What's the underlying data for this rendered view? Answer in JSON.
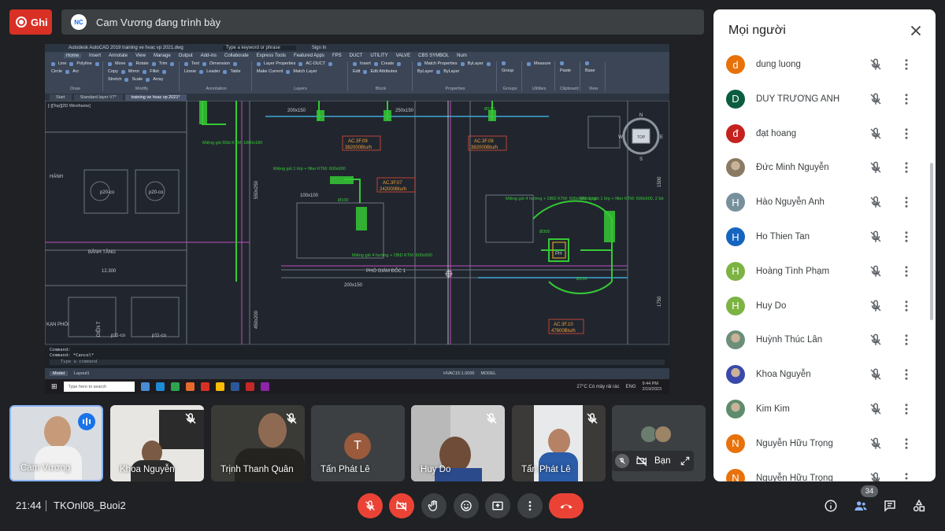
{
  "recording": {
    "label": "Ghi"
  },
  "presenter": {
    "initials": "NC",
    "text": "Cam Vương đang trình bày"
  },
  "shared_screen": {
    "window_title": "Autodesk AutoCAD 2019   training ve hvac vp 2021.dwg",
    "search_placeholder": "Type a keyword or phrase",
    "sign_in": "Sign In",
    "menu": [
      "Home",
      "Insert",
      "Annotate",
      "View",
      "Manage",
      "Output",
      "Add-ins",
      "Collaborate",
      "Express Tools",
      "Featured Apps",
      "FPS",
      "DUCT",
      "UTILITY",
      "VALVE",
      "CBS SYMBOL",
      "Num"
    ],
    "ribbon_groups": [
      {
        "label": "Draw",
        "items": [
          "Line",
          "Polyline",
          "Circle",
          "Arc"
        ]
      },
      {
        "label": "Modify",
        "items": [
          "Move",
          "Rotate",
          "Trim",
          "Copy",
          "Mirror",
          "Fillet",
          "Stretch",
          "Scale",
          "Array"
        ]
      },
      {
        "label": "Annotation",
        "items": [
          "Text",
          "Dimension",
          "Linear",
          "Leader",
          "Table"
        ]
      },
      {
        "label": "Layers",
        "items": [
          "Layer Properties",
          "AC-DUCT",
          "Make Current",
          "Match Layer"
        ]
      },
      {
        "label": "Block",
        "items": [
          "Insert",
          "Create",
          "Edit",
          "Edit Attributes"
        ]
      },
      {
        "label": "Properties",
        "items": [
          "Match Properties",
          "ByLayer",
          "ByLayer",
          "ByLayer"
        ]
      },
      {
        "label": "Groups",
        "items": [
          "Group"
        ]
      },
      {
        "label": "Utilities",
        "items": [
          "Measure"
        ]
      },
      {
        "label": "Clipboard",
        "items": [
          "Paste"
        ]
      },
      {
        "label": "View",
        "items": [
          "Base"
        ]
      }
    ],
    "doc_tabs": [
      "Start",
      "Standard layer V7*",
      "training ve hvac vp 2021*"
    ],
    "viewport_label": "[-][Top][2D Wireframe]",
    "viewcube": {
      "n": "N",
      "s": "S",
      "e": "E",
      "w": "W",
      "top": "TOP"
    },
    "drawing_labels": {
      "ac3f09": "AC.3F.09",
      "ac3f09_cap": "382000Btu/h",
      "ac3f08": "AC.3F.08",
      "ac3f08_cap": "382000Btu/h",
      "ac3f07": "AC.3F.07",
      "ac3f07_cap": "242000Btu/h",
      "ac3f10": "AC.3F.10",
      "ac3f10_cap": "47800Btu/h",
      "room1": "PHÓ GIÁM ĐỐC 1",
      "room2": "BẢNH TĂNG",
      "room3": "HÀNH",
      "room4": "PH",
      "room5": "KẠN PHÒI",
      "room6": "DIỆN T",
      "mieng_gio1": "Miệng gió 55kt KTM: 1800x180",
      "mieng_gio2": "Miệng gió 1 lớp + filter KTM: 600x600",
      "mieng_gio3": "Miệng gió 4 hướng + OBD KTM: 600x600",
      "mieng_gio4": "Miệng gió 4 hướng + OBD KTM: 600x600, 2 bộ",
      "mieng_gio5": "Miệng gió 1 lớp + filter KTM: 600x600, 2 bộ",
      "dim_200x150": "200x150",
      "dim_250x150": "250x150",
      "dim_100x100": "100x100",
      "dim_550x250": "550x250",
      "dim_450x200": "450x200",
      "d100": "Ø100",
      "d150": "Ø150",
      "d200": "Ø200",
      "d300": "Ø300",
      "p20co": "p20-co",
      "p11co": "p11-co",
      "level": "12.300",
      "dim_1750": "1750",
      "dim_1500": "1500"
    },
    "command_lines": [
      "Command:",
      "Command: *Cancel*"
    ],
    "command_prompt": "Type a command",
    "layout_tabs": [
      "Model",
      "Layout1"
    ],
    "status_text": "MODEL",
    "scale": "HVAC15:1.0000",
    "taskbar": {
      "search": "Type here to search",
      "weather": "27°C  Có mây rải rác",
      "lang": "ENG",
      "time": "9:44 PM",
      "date": "2/19/2023"
    }
  },
  "tiles": [
    {
      "name": "Cam Vương",
      "speaking": true
    },
    {
      "name": "Khoa Nguyễn",
      "muted": true
    },
    {
      "name": "Trịnh Thanh Quân",
      "muted": true
    },
    {
      "name": "Tấn Phát Lê",
      "avatar_letter": "T",
      "muted": false
    },
    {
      "name": "Huy Do",
      "muted": true
    },
    {
      "name": "Tấn Phát Lê",
      "muted": true
    },
    {
      "name": "Bạn",
      "self": true
    }
  ],
  "people_panel": {
    "title": "Mọi người",
    "people": [
      {
        "name": "dung luong",
        "initial": "d",
        "color": "#e8710a"
      },
      {
        "name": "DUY TRƯƠNG ANH",
        "initial": "D",
        "color": "#0b5d3f"
      },
      {
        "name": "đạt hoang",
        "initial": "đ",
        "color": "#c5221f"
      },
      {
        "name": "Đức Minh Nguyễn",
        "initial": "",
        "color": "#8a7a64",
        "photo": true
      },
      {
        "name": "Hào Nguyễn Anh",
        "initial": "H",
        "color": "#78909c"
      },
      {
        "name": "Ho Thien Tan",
        "initial": "H",
        "color": "#1565c0"
      },
      {
        "name": "Hoàng Tình Phạm",
        "initial": "H",
        "color": "#7cb342"
      },
      {
        "name": "Huy Do",
        "initial": "H",
        "color": "#7cb342"
      },
      {
        "name": "Huỳnh Thúc Lân",
        "initial": "",
        "color": "#6d8f7a",
        "photo": true
      },
      {
        "name": "Khoa Nguyễn",
        "initial": "",
        "color": "#3949ab",
        "photo": true
      },
      {
        "name": "Kim Kim",
        "initial": "",
        "color": "#5f8b6e",
        "photo": true
      },
      {
        "name": "Nguyễn Hữu Trọng",
        "initial": "N",
        "color": "#e8710a"
      },
      {
        "name": "Nguyễn Hữu Trọng",
        "initial": "N",
        "color": "#e8710a"
      }
    ]
  },
  "bottom_bar": {
    "time": "21:44",
    "meeting_code": "TKOnl08_Buoi2",
    "participant_count": "34"
  }
}
